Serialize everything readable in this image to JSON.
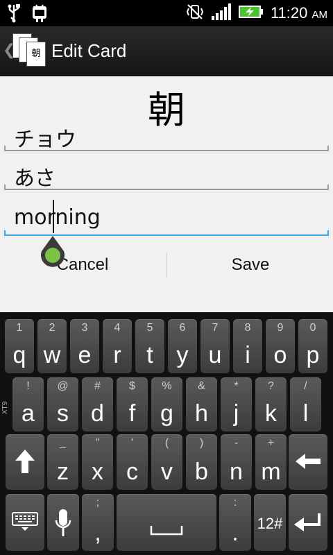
{
  "status_bar": {
    "time": "11:20",
    "ampm": "AM",
    "icons": [
      "usb-icon",
      "android-debug-icon",
      "vibrate-icon",
      "signal-icon",
      "battery-charging-icon"
    ]
  },
  "action_bar": {
    "app_icon_char": "朝",
    "title": "Edit Card"
  },
  "card": {
    "kanji": "朝",
    "reading_on": "チョウ",
    "reading_kun": "あさ",
    "meaning": "morning"
  },
  "buttons": {
    "cancel": "Cancel",
    "save": "Save"
  },
  "keyboard": {
    "side_label": "XT9",
    "row1": [
      {
        "hint": "1",
        "key": "q"
      },
      {
        "hint": "2",
        "key": "w"
      },
      {
        "hint": "3",
        "key": "e"
      },
      {
        "hint": "4",
        "key": "r"
      },
      {
        "hint": "5",
        "key": "t"
      },
      {
        "hint": "6",
        "key": "y"
      },
      {
        "hint": "7",
        "key": "u"
      },
      {
        "hint": "8",
        "key": "i"
      },
      {
        "hint": "9",
        "key": "o"
      },
      {
        "hint": "0",
        "key": "p"
      }
    ],
    "row2": [
      {
        "hint": "!",
        "key": "a"
      },
      {
        "hint": "@",
        "key": "s"
      },
      {
        "hint": "#",
        "key": "d"
      },
      {
        "hint": "$",
        "key": "f"
      },
      {
        "hint": "%",
        "key": "g"
      },
      {
        "hint": "&",
        "key": "h"
      },
      {
        "hint": "*",
        "key": "j"
      },
      {
        "hint": "?",
        "key": "k"
      },
      {
        "hint": "/",
        "key": "l"
      }
    ],
    "row3": [
      {
        "hint": "_",
        "key": "z"
      },
      {
        "hint": "\"",
        "key": "x"
      },
      {
        "hint": "'",
        "key": "c"
      },
      {
        "hint": "(",
        "key": "v"
      },
      {
        "hint": ")",
        "key": "b"
      },
      {
        "hint": "-",
        "key": "n"
      },
      {
        "hint": "+",
        "key": "m"
      }
    ],
    "comma_key": ",",
    "comma_hint": ";",
    "period_key": ".",
    "period_hint": ":",
    "num_key": "12#"
  }
}
